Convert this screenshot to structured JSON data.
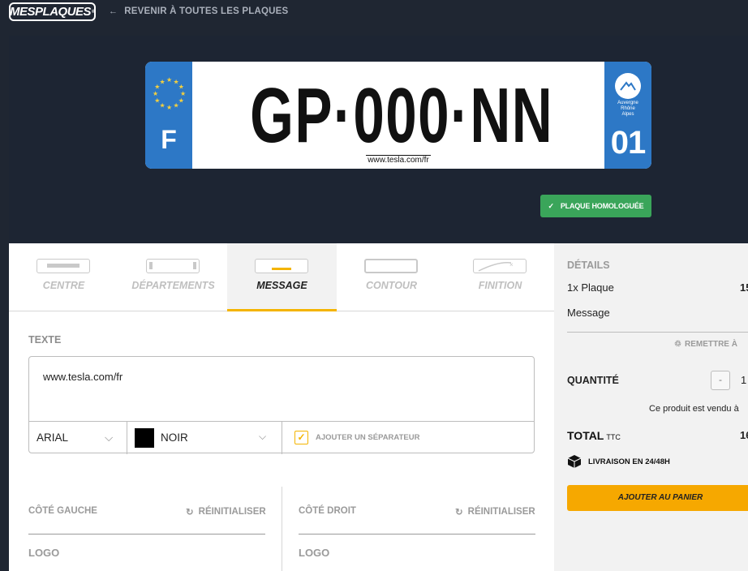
{
  "header": {
    "logo": "MESPLAQUES",
    "back_link": "REVENIR À TOUTES LES PLAQUES"
  },
  "plate": {
    "registration": "GP·000·NN",
    "country_letter": "F",
    "region_name": "Auvergne\nRhône\nAlpes",
    "department": "01",
    "url_text": "www.tesla.com/fr",
    "homologation_badge": "PLAQUE HOMOLOGUÉE"
  },
  "tabs": [
    {
      "label": "CENTRE",
      "active": false
    },
    {
      "label": "DÉPARTEMENTS",
      "active": false
    },
    {
      "label": "MESSAGE",
      "active": true
    },
    {
      "label": "CONTOUR",
      "active": false
    },
    {
      "label": "FINITION",
      "active": false
    }
  ],
  "message": {
    "section_label": "TEXTE",
    "text_value": "www.tesla.com/fr",
    "font_value": "ARIAL",
    "color_value": "NOIR",
    "color_hex": "#000000",
    "separator_label": "AJOUTER UN SÉPARATEUR",
    "separator_checked": true
  },
  "sides": {
    "left_title": "CÔTÉ GAUCHE",
    "right_title": "CÔTÉ DROIT",
    "reset_label": "RÉINITIALISER",
    "logo_label": "LOGO"
  },
  "details": {
    "title": "DÉTAILS",
    "line1": "1x Plaque",
    "line1_price": "15",
    "line2": "Message",
    "reset_all": "REMETTRE À",
    "quantity_label": "QUANTITÉ",
    "quantity_minus": "-",
    "quantity_value": "1",
    "sold_note": "Ce produit est vendu à",
    "total_label": "TOTAL",
    "total_suffix": "TTC",
    "total_value": "16",
    "delivery": "LIVRAISON EN 24/48H",
    "add_to_cart": "AJOUTER AU PANIER"
  },
  "colors": {
    "accent": "#f4b400",
    "eu_blue": "#2d78c6",
    "badge_green": "#3aa55a",
    "dark_bg": "#1f2632"
  }
}
